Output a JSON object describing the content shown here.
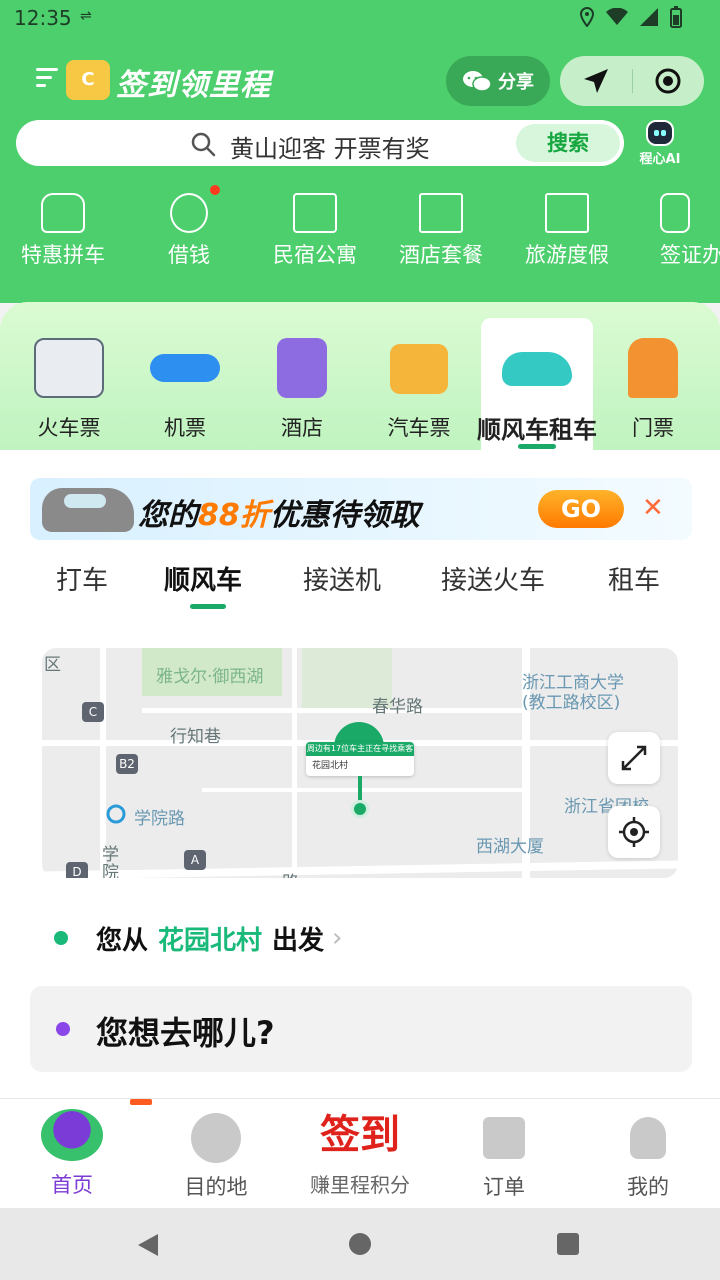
{
  "status_bar": {
    "time": "12:35"
  },
  "header": {
    "title": "签到领里程",
    "share_label": "分享",
    "search_placeholder": "黄山迎客 开票有奖",
    "search_button": "搜索",
    "ai_label": "程心AI"
  },
  "quick_items": [
    {
      "label": "特惠拼车",
      "icon": "car-pool-icon"
    },
    {
      "label": "借钱",
      "icon": "money-bag-icon",
      "badge": true
    },
    {
      "label": "民宿公寓",
      "icon": "house-icon"
    },
    {
      "label": "酒店套餐",
      "icon": "hotel-package-icon"
    },
    {
      "label": "旅游度假",
      "icon": "mountain-icon"
    },
    {
      "label": "签证办",
      "icon": "passport-icon"
    }
  ],
  "transport": [
    {
      "label": "火车票",
      "icon": "train-icon",
      "color": "#e9edf2"
    },
    {
      "label": "机票",
      "icon": "plane-icon",
      "color": "#2d8ff0"
    },
    {
      "label": "酒店",
      "icon": "hotel-icon",
      "color": "#8c6ce0"
    },
    {
      "label": "汽车票",
      "icon": "bus-icon",
      "color": "#f5b53a"
    },
    {
      "label": "顺风车租车",
      "icon": "car-icon",
      "color": "#35c9c4",
      "active": true
    },
    {
      "label": "门票",
      "icon": "temple-icon",
      "color": "#f29230"
    }
  ],
  "promo": {
    "text_before": "您的",
    "text_highlight": "88折",
    "text_after": "优惠待领取",
    "go_label": "GO"
  },
  "tabs": [
    {
      "label": "打车"
    },
    {
      "label": "顺风车",
      "active": true
    },
    {
      "label": "接送机"
    },
    {
      "label": "接送火车"
    },
    {
      "label": "租车"
    }
  ],
  "map": {
    "labels": {
      "district": "区",
      "yage": "雅戈尔·御西湖",
      "chunhua": "春华路",
      "zjgs": "浙江工商大学",
      "zjgs_sub": "(教工路校区)",
      "xingzhi": "行知巷",
      "xueyuan": "学院路",
      "zjsf": "浙江省团校",
      "xihu": "西湖大厦",
      "xue": "学",
      "yuan": "院",
      "lu": "路"
    },
    "badges": {
      "c": "C",
      "b2": "B2",
      "a": "A",
      "d": "D"
    },
    "pin": {
      "notice": "周边有17位车主正在寻找乘客",
      "location": "花园北村"
    }
  },
  "trip": {
    "from_prefix": "您从",
    "from_place": "花园北村",
    "from_suffix": "出发",
    "destination_placeholder": "您想去哪儿?"
  },
  "bottom_nav": {
    "home": "首页",
    "destination": "目的地",
    "checkin_big": "签到",
    "checkin_label": "赚里程积分",
    "orders": "订单",
    "mine": "我的"
  },
  "colors": {
    "header_green": "#4dcf6d",
    "accent_green": "#1ba968",
    "promo_orange": "#ff7a00",
    "active_purple": "#7b3bd6"
  }
}
